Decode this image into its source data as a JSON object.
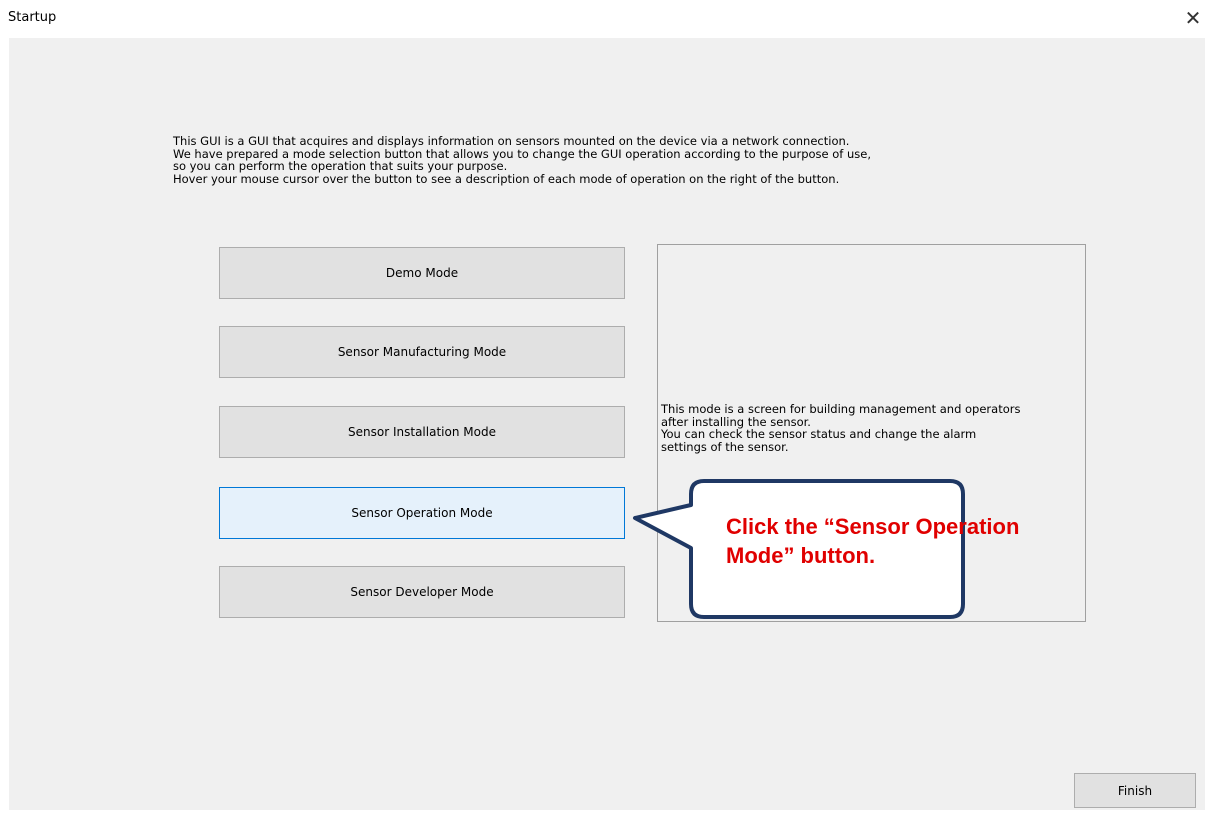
{
  "window": {
    "title": "Startup",
    "close_glyph": "✕",
    "close_icon": "close-icon"
  },
  "intro": {
    "lines": [
      "This GUI is a GUI that acquires and displays information on sensors mounted on the device via a network connection.",
      "We have prepared a mode selection button that allows you to change the GUI operation according to the purpose of use,",
      "so you can perform the operation that suits your purpose.",
      "Hover your mouse cursor over the button to see a description of each mode of operation on the right of the button."
    ]
  },
  "modes": [
    {
      "label": "Demo Mode",
      "active": false
    },
    {
      "label": "Sensor Manufacturing Mode",
      "active": false
    },
    {
      "label": "Sensor Installation Mode",
      "active": false
    },
    {
      "label": "Sensor Operation Mode",
      "active": true
    },
    {
      "label": "Sensor Developer Mode",
      "active": false
    }
  ],
  "description": {
    "lines": [
      "This mode is a screen for building management and operators",
      "after installing the sensor.",
      "You can check the sensor status and change the alarm",
      "settings of the sensor."
    ]
  },
  "finish_button": {
    "label": "Finish"
  },
  "callout": {
    "lines": [
      "Click the “Sensor Operation",
      "Mode” button."
    ],
    "text_color": "#e00000",
    "border_color": "#1f3864"
  },
  "colors": {
    "active_button_bg": "#e5f1fb",
    "active_button_border": "#0078d7",
    "button_bg": "#e1e1e1",
    "client_bg": "#f0f0f0"
  }
}
